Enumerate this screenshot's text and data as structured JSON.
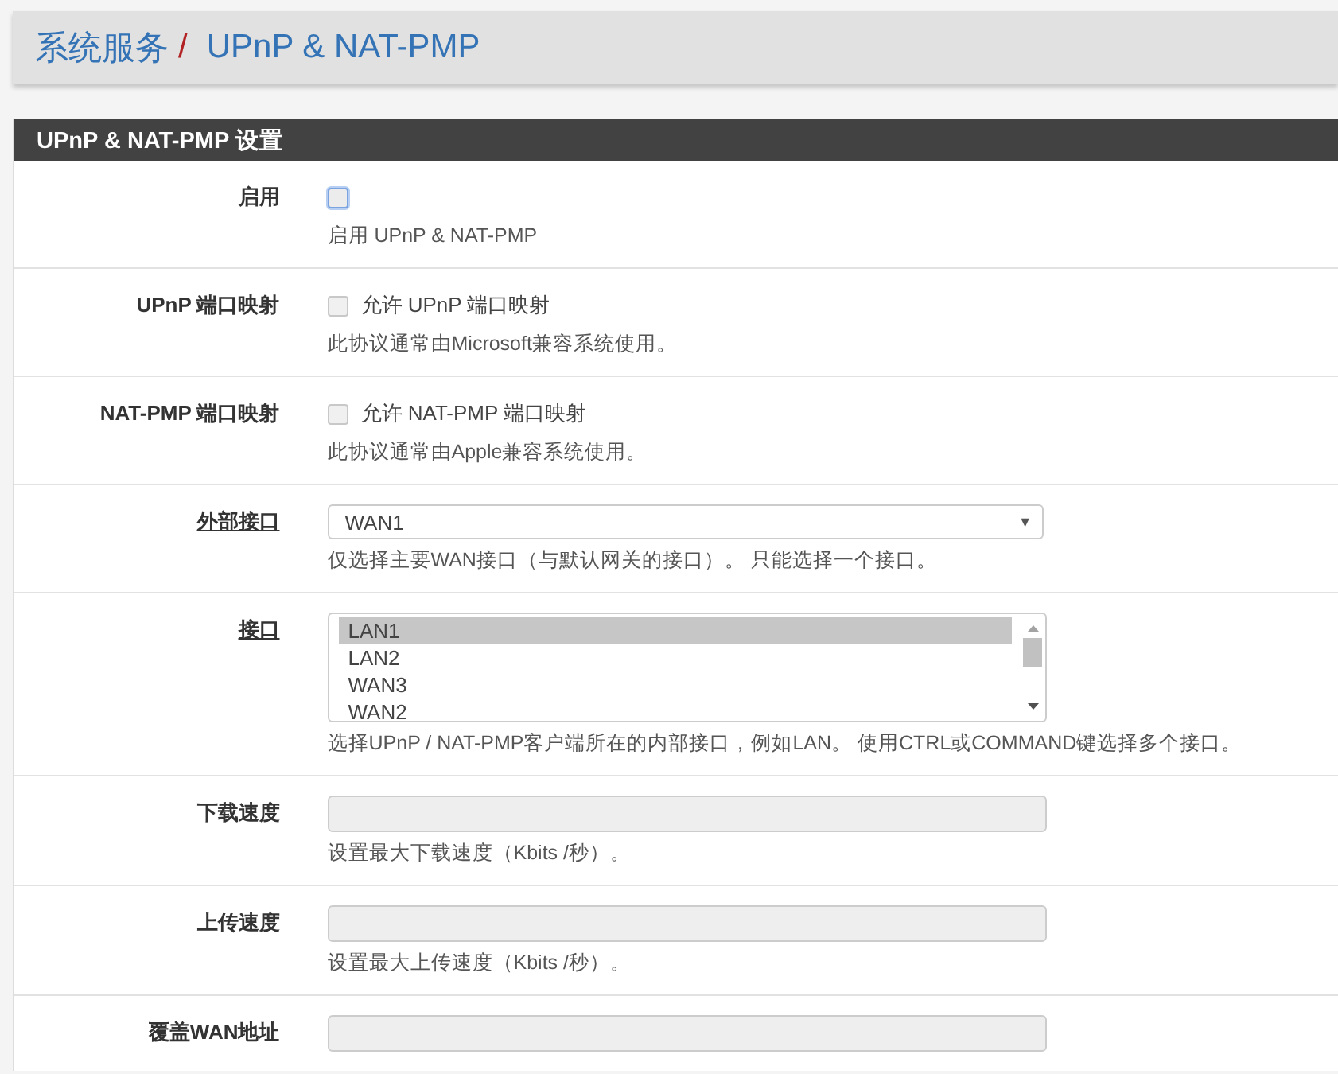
{
  "breadcrumb": {
    "section": "系统服务",
    "separator": "/",
    "page": "UPnP & NAT-PMP"
  },
  "panel": {
    "title": "UPnP & NAT-PMP 设置",
    "rows": [
      {
        "kind": "checkbox",
        "label": "启用",
        "label_link": false,
        "checked": false,
        "disabled": false,
        "help": "启用 UPnP & NAT-PMP"
      },
      {
        "kind": "checkbox",
        "label": "UPnP 端口映射",
        "label_link": false,
        "checked": false,
        "disabled": true,
        "option": "允许 UPnP 端口映射",
        "help": "此协议通常由Microsoft兼容系统使用。"
      },
      {
        "kind": "checkbox",
        "label": "NAT-PMP 端口映射",
        "label_link": false,
        "checked": false,
        "disabled": true,
        "option": "允许 NAT-PMP 端口映射",
        "help": "此协议通常由Apple兼容系统使用。"
      },
      {
        "kind": "select",
        "label": "外部接口",
        "label_link": true,
        "value": "WAN1",
        "arrow": "▼",
        "help": "仅选择主要WAN接口（与默认网关的接口）。 只能选择一个接口。"
      },
      {
        "kind": "listbox",
        "label": "接口",
        "label_link": true,
        "options": [
          {
            "label": "LAN1",
            "selected": true
          },
          {
            "label": "LAN2",
            "selected": false
          },
          {
            "label": "WAN3",
            "selected": false
          },
          {
            "label": "WAN2",
            "selected": false
          }
        ],
        "help": "选择UPnP / NAT-PMP客户端所在的内部接口，例如LAN。 使用CTRL或COMMAND键选择多个接口。"
      },
      {
        "kind": "text",
        "label": "下载速度",
        "label_link": false,
        "disabled": true,
        "help": "设置最大下载速度（Kbits /秒）。"
      },
      {
        "kind": "text",
        "label": "上传速度",
        "label_link": false,
        "disabled": true,
        "help": "设置最大上传速度（Kbits /秒）。"
      },
      {
        "kind": "text",
        "label": "覆盖WAN地址",
        "label_link": false,
        "disabled": true
      }
    ]
  }
}
